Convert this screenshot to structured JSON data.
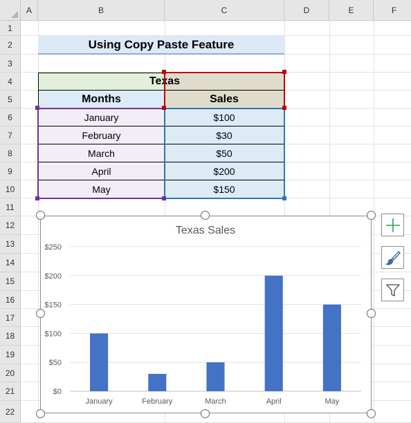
{
  "columns": [
    "A",
    "B",
    "C",
    "D",
    "E",
    "F"
  ],
  "rows": [
    "1",
    "2",
    "3",
    "4",
    "5",
    "6",
    "7",
    "8",
    "9",
    "10",
    "11",
    "12",
    "13",
    "14",
    "15",
    "16",
    "17",
    "18",
    "19",
    "20",
    "21",
    "22"
  ],
  "title": "Using Copy Paste Feature",
  "table": {
    "group_header": "Texas",
    "col1_header": "Months",
    "col2_header": "Sales",
    "rows": [
      {
        "month": "January",
        "sales": "$100"
      },
      {
        "month": "February",
        "sales": "$30"
      },
      {
        "month": "March",
        "sales": "$50"
      },
      {
        "month": "April",
        "sales": "$200"
      },
      {
        "month": "May",
        "sales": "$150"
      }
    ]
  },
  "chart_data": {
    "type": "bar",
    "title": "Texas Sales",
    "categories": [
      "January",
      "February",
      "March",
      "April",
      "May"
    ],
    "values": [
      100,
      30,
      50,
      200,
      150
    ],
    "ylim": [
      0,
      250
    ],
    "yticks": [
      "$0",
      "$50",
      "$100",
      "$150",
      "$200",
      "$250"
    ],
    "grid": true,
    "bar_color": "#4472c4"
  },
  "chart_buttons": {
    "add_elements": "plus-icon",
    "styles": "brush-icon",
    "filters": "funnel-icon"
  },
  "colors": {
    "title_fill": "#dde9f7",
    "green_header": "#e2efda",
    "tan_header": "#dfdccb",
    "blue_header": "#ddebf7",
    "purple_cells": "#f2eef8",
    "blue_cells": "#ddebf7",
    "selection_purple": "#7030a0",
    "selection_blue": "#2e75b6",
    "selection_red": "#c00000"
  }
}
